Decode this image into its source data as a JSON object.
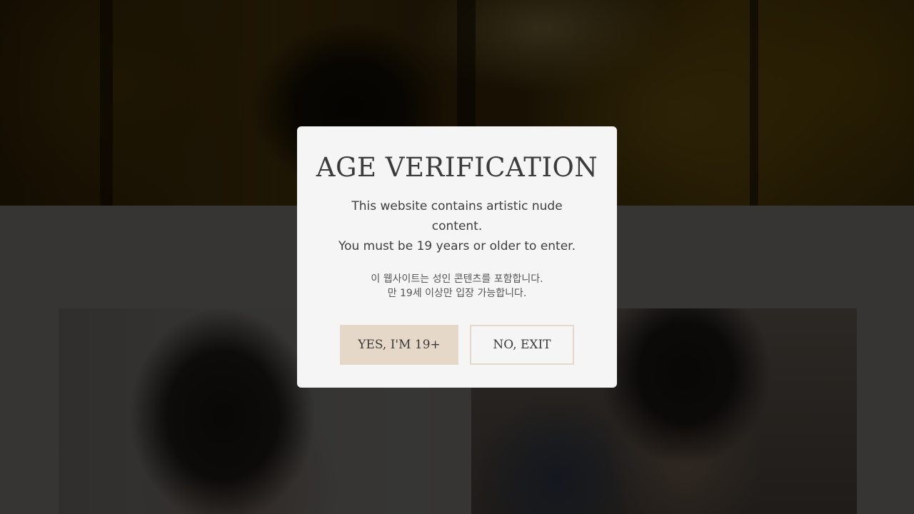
{
  "modal": {
    "title": "AGE VERIFICATION",
    "body_en_line1": "This website contains artistic nude content.",
    "body_en_line2": "You must be 19 years or older to enter.",
    "body_ko_line1": "이 웹사이트는 성인 콘텐츠를 포함합니다.",
    "body_ko_line2": "만 19세 이상만 입장 가능합니다.",
    "confirm_label": "YES, I'M 19+",
    "exit_label": "NO, EXIT"
  },
  "colors": {
    "modal_background": "#f5f5f5",
    "accent_beige": "#e6d8c8",
    "overlay": "rgba(0,0,0,0.78)",
    "text_dark": "#3b3b3b"
  }
}
